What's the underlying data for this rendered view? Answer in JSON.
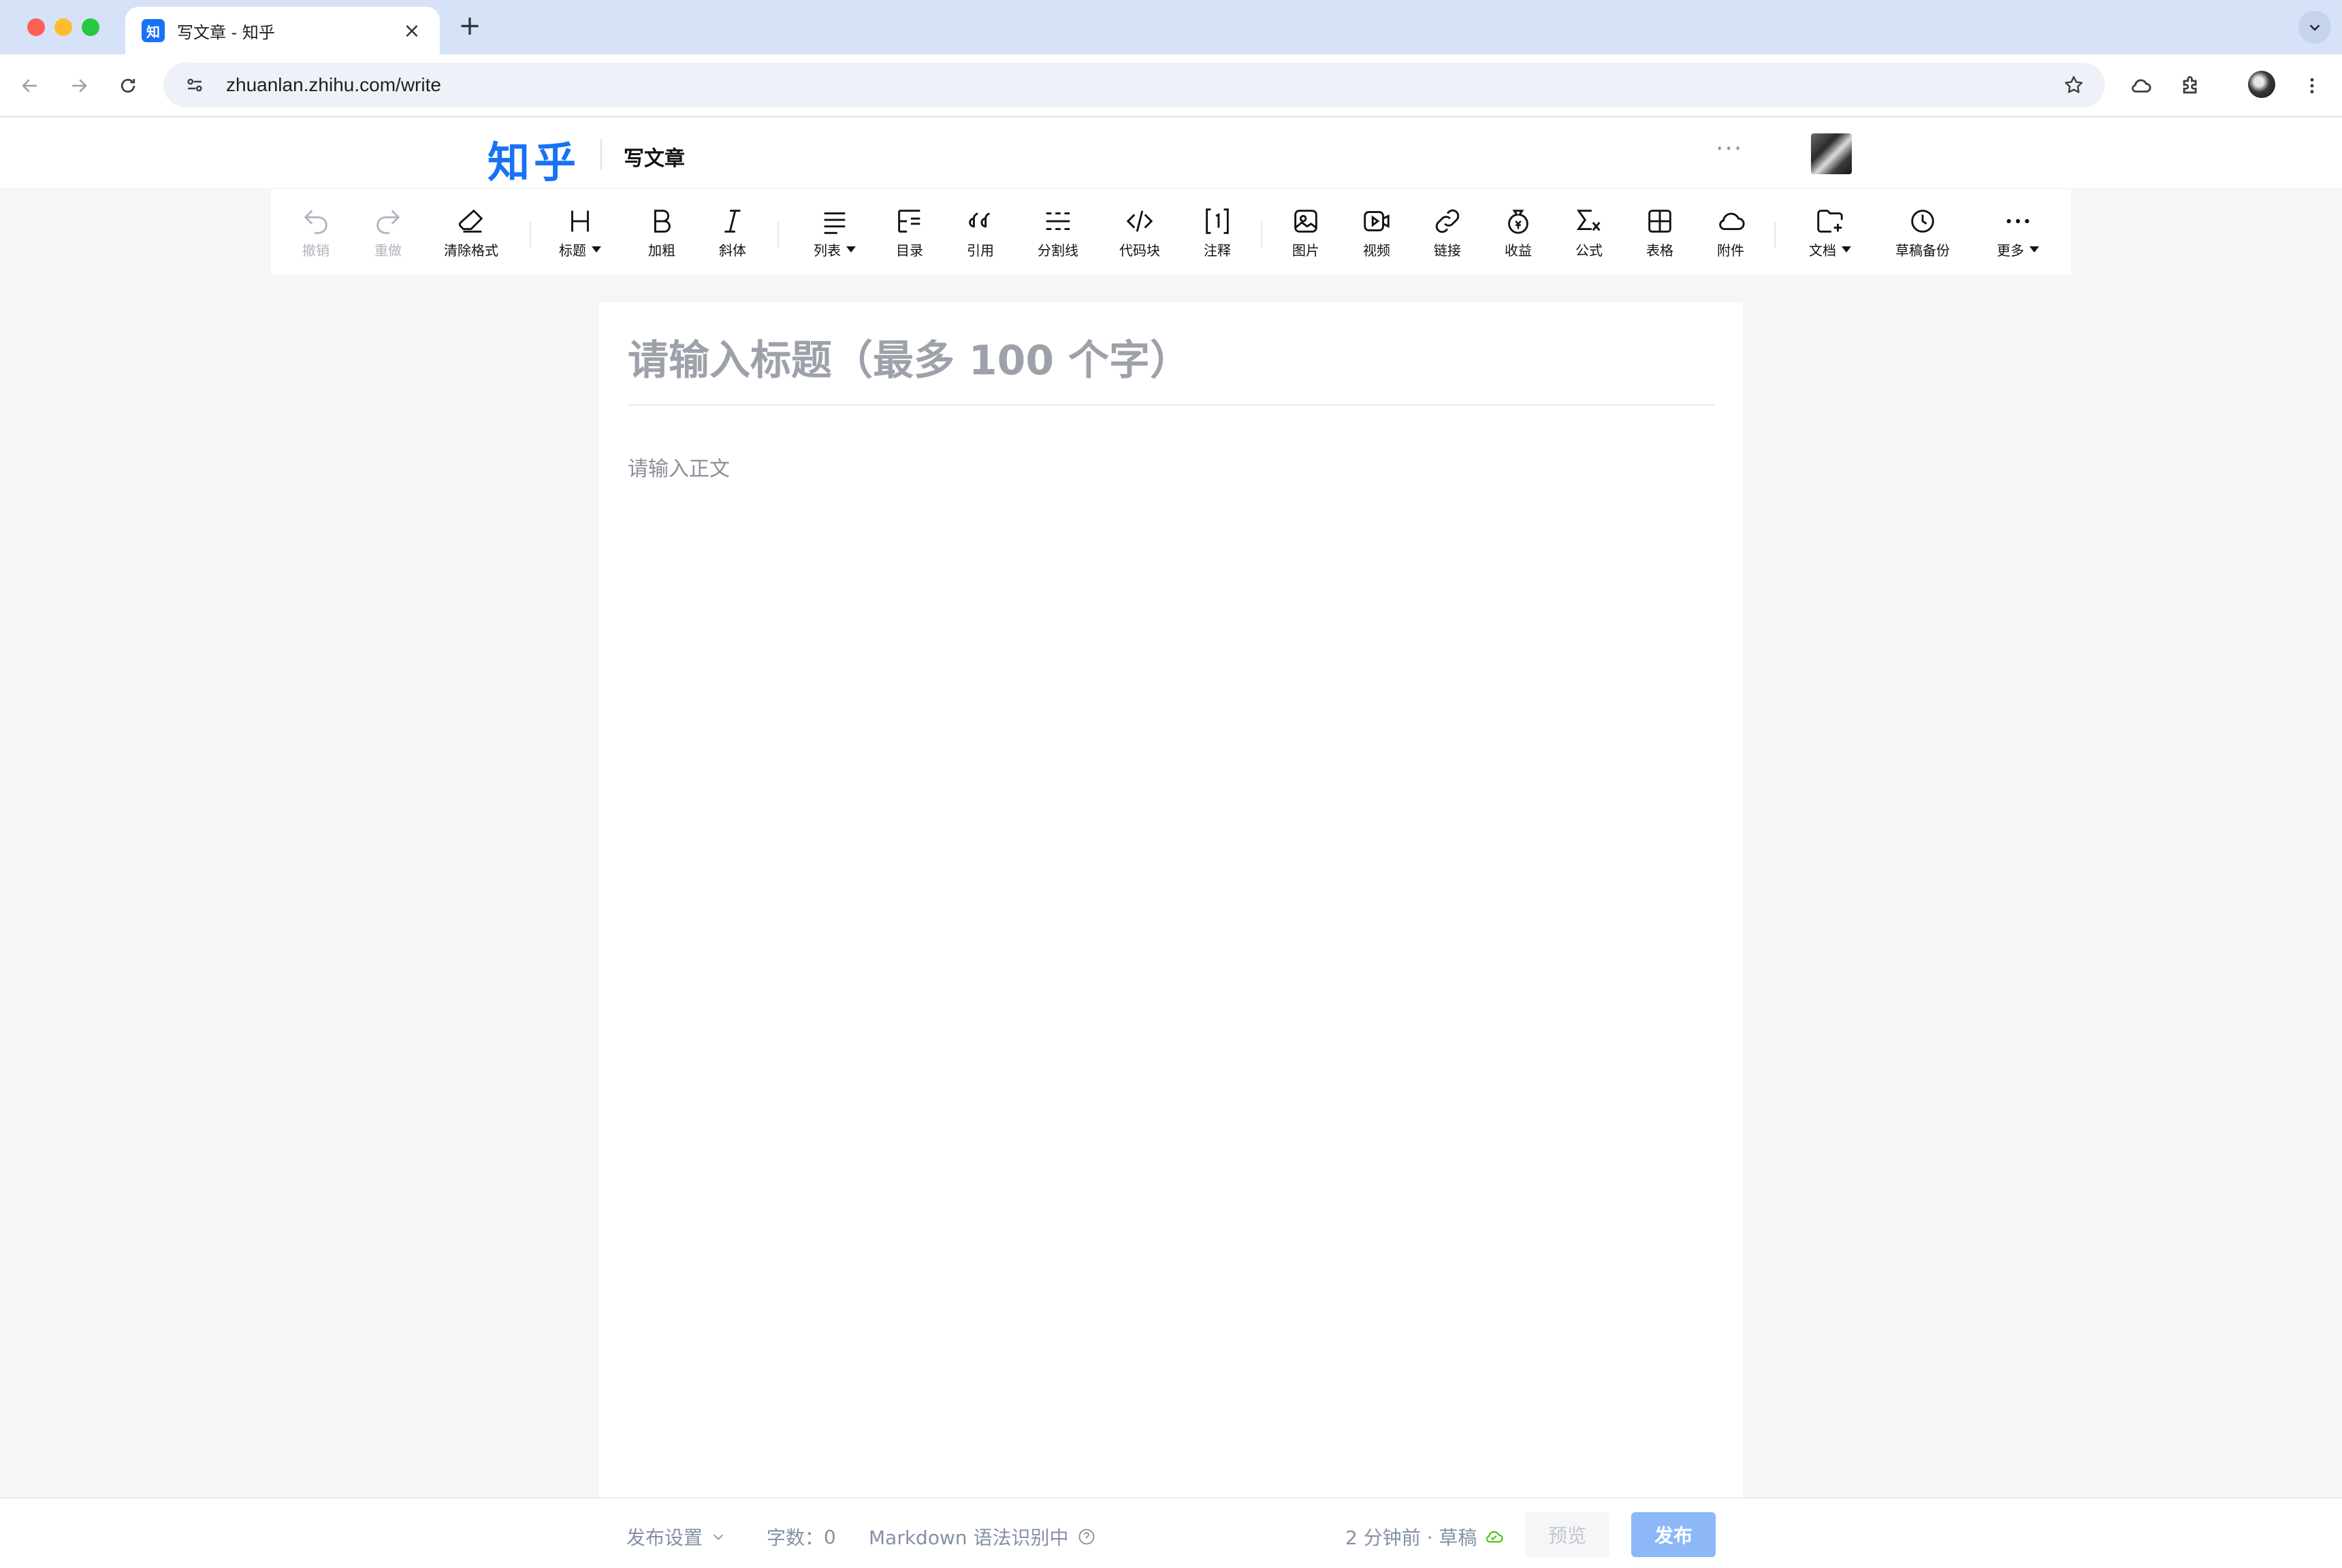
{
  "browser": {
    "tab_title": "写文章 - 知乎",
    "tab_favicon_text": "知",
    "url": "zhuanlan.zhihu.com/write"
  },
  "header": {
    "logo": "知乎",
    "page_title": "写文章",
    "more": "···"
  },
  "toolbar": {
    "undo": "撤销",
    "redo": "重做",
    "clear_format": "清除格式",
    "heading": "标题",
    "bold": "加粗",
    "italic": "斜体",
    "list": "列表",
    "toc": "目录",
    "quote": "引用",
    "divider": "分割线",
    "code_block": "代码块",
    "footnote": "注释",
    "image": "图片",
    "video": "视频",
    "link": "链接",
    "income": "收益",
    "formula": "公式",
    "table": "表格",
    "attachment": "附件",
    "document": "文档",
    "draft_backup": "草稿备份",
    "more": "更多"
  },
  "editor": {
    "title_placeholder": "请输入标题（最多 100 个字）",
    "body_placeholder": "请输入正文"
  },
  "footer": {
    "publish_settings": "发布设置",
    "word_count_label": "字数：",
    "word_count": "0",
    "markdown_status": "Markdown 语法识别中",
    "save_status": "2 分钟前 · 草稿",
    "preview": "预览",
    "publish": "发布"
  },
  "colors": {
    "brand": "#1772f6",
    "publish_disabled": "#8cb8f8",
    "saved_icon": "#52c41a"
  }
}
